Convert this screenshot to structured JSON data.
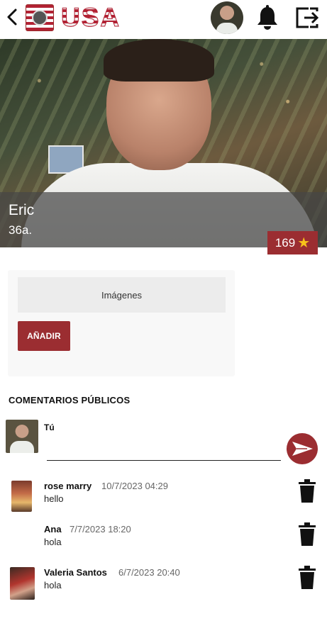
{
  "header": {
    "logo_text": "USA",
    "icons": {
      "back": "chevron-left-icon",
      "bell": "bell-icon",
      "logout": "logout-icon"
    }
  },
  "profile": {
    "name": "Eric",
    "age": "36a.",
    "points": "169",
    "points_icon": "★"
  },
  "images": {
    "tab_label": "Imágenes",
    "add_label": "AÑADIR"
  },
  "comments": {
    "heading": "COMENTARIOS PÚBLICOS",
    "composer": {
      "author_label": "Tú",
      "input_value": "",
      "input_placeholder": ""
    },
    "items": [
      {
        "author": "rose marry",
        "date": "10/7/2023 04:29",
        "text": "hello"
      },
      {
        "author": "Ana",
        "date": "7/7/2023 18:20",
        "text": "hola"
      },
      {
        "author": "Valeria Santos",
        "date": "6/7/2023 20:40",
        "text": "hola"
      }
    ]
  },
  "colors": {
    "accent": "#9b2d31",
    "star": "#f7c21a",
    "overlay": "#464646"
  }
}
